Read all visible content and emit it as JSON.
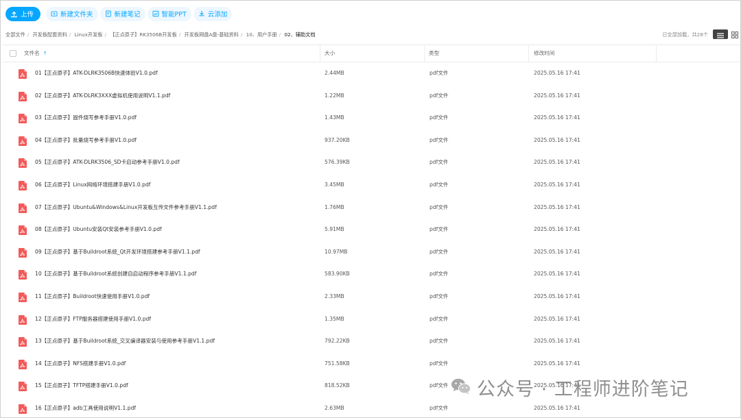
{
  "toolbar": {
    "upload": "上传",
    "new_folder": "新建文件夹",
    "new_note": "新建笔记",
    "smart_ppt": "智能PPT",
    "cloud_add": "云添加"
  },
  "breadcrumb": [
    "全部文件",
    "开发板配套资料",
    "Linux开发板",
    "【正点原子】RK3506B开发板",
    "开发板网盘A盘-基础资料",
    "10、用户手册",
    "02、辅助文档"
  ],
  "summary": "已全部加载，共28个",
  "table": {
    "headers": {
      "name": "文件名",
      "size": "大小",
      "type": "类型",
      "modified": "修改时间"
    },
    "rows": [
      {
        "name": "01【正点原子】ATK-DLRK3506B快速体验V1.0.pdf",
        "size": "2.44MB",
        "type": "pdf文件",
        "modified": "2025.05.16 17:41"
      },
      {
        "name": "02【正点原子】ATK-DLRK3XXX虚拟机使用说明V1.1.pdf",
        "size": "1.22MB",
        "type": "pdf文件",
        "modified": "2025.05.16 17:41"
      },
      {
        "name": "03【正点原子】固件烧写参考手册V1.0.pdf",
        "size": "1.43MB",
        "type": "pdf文件",
        "modified": "2025.05.16 17:41"
      },
      {
        "name": "04【正点原子】批量烧写参考手册V1.0.pdf",
        "size": "937.20KB",
        "type": "pdf文件",
        "modified": "2025.05.16 17:41"
      },
      {
        "name": "05【正点原子】ATK-DLRK3506_SD卡启动参考手册V1.0.pdf",
        "size": "576.39KB",
        "type": "pdf文件",
        "modified": "2025.05.16 17:41"
      },
      {
        "name": "06【正点原子】Linux网络环境搭建手册V1.0.pdf",
        "size": "3.45MB",
        "type": "pdf文件",
        "modified": "2025.05.16 17:41"
      },
      {
        "name": "07【正点原子】Ubuntu&Windows&Linux开发板互传文件参考手册V1.1.pdf",
        "size": "1.76MB",
        "type": "pdf文件",
        "modified": "2025.05.16 17:41"
      },
      {
        "name": "08【正点原子】Ubuntu安装Qt安装参考手册V1.0.pdf",
        "size": "5.91MB",
        "type": "pdf文件",
        "modified": "2025.05.16 17:41"
      },
      {
        "name": "09【正点原子】基于Buildroot系统_Qt开发环境搭建参考手册V1.1.pdf",
        "size": "10.97MB",
        "type": "pdf文件",
        "modified": "2025.05.16 17:41"
      },
      {
        "name": "10【正点原子】基于Buildroot系统创建自启动程序参考手册V1.1.pdf",
        "size": "583.90KB",
        "type": "pdf文件",
        "modified": "2025.05.16 17:41"
      },
      {
        "name": "11【正点原子】Buildroot快速使用手册V1.0.pdf",
        "size": "2.33MB",
        "type": "pdf文件",
        "modified": "2025.05.16 17:41"
      },
      {
        "name": "12【正点原子】FTP服务器搭建使用手册V1.0.pdf",
        "size": "1.35MB",
        "type": "pdf文件",
        "modified": "2025.05.16 17:41"
      },
      {
        "name": "13【正点原子】基于Buildroot系统_交叉编译器安装与使用参考手册V1.1.pdf",
        "size": "792.22KB",
        "type": "pdf文件",
        "modified": "2025.05.16 17:41"
      },
      {
        "name": "14【正点原子】NFS搭建手册V1.0.pdf",
        "size": "751.58KB",
        "type": "pdf文件",
        "modified": "2025.05.16 17:41"
      },
      {
        "name": "15【正点原子】TFTP搭建手册V1.0.pdf",
        "size": "818.52KB",
        "type": "pdf文件",
        "modified": "2025.05.16 17:41"
      },
      {
        "name": "16【正点原子】adb工具使用说明V1.1.pdf",
        "size": "2.63MB",
        "type": "pdf文件",
        "modified": "2025.05.16 17:41"
      }
    ]
  },
  "watermark": {
    "text": "公众号 · 工程师进阶笔记",
    "icon": "wechat-icon"
  },
  "colors": {
    "accent": "#06a7ff",
    "accent_light": "#eef7ff",
    "pdf_red": "#f35a5a"
  }
}
